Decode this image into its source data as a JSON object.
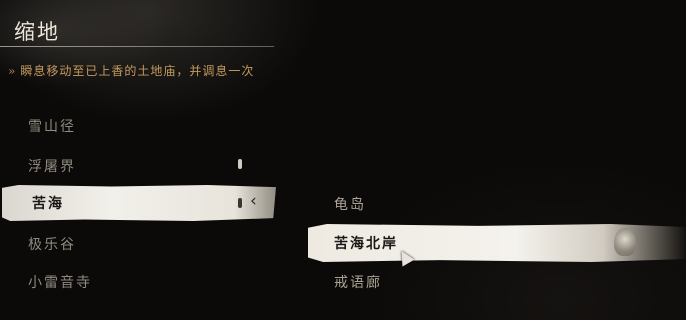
{
  "header": {
    "title": "缩地",
    "hint_arrow": "»",
    "hint": "瞬息移动至已上香的土地庙，并调息一次"
  },
  "regions": [
    {
      "label": "雪山径",
      "selected": false
    },
    {
      "label": "浮屠界",
      "selected": false
    },
    {
      "label": "苦海",
      "selected": true
    },
    {
      "label": "极乐谷",
      "selected": false
    },
    {
      "label": "小雷音寺",
      "selected": false
    }
  ],
  "submenu_chevron": "‹",
  "shrines": [
    {
      "label": "龟岛",
      "selected": false
    },
    {
      "label": "苦海北岸",
      "selected": true
    },
    {
      "label": "戒语廊",
      "selected": false
    }
  ],
  "colors": {
    "hint": "#c49a5c",
    "selected_text": "#1a1816",
    "unselected_text": "#8f897f",
    "highlight": "#f2f0ea"
  }
}
